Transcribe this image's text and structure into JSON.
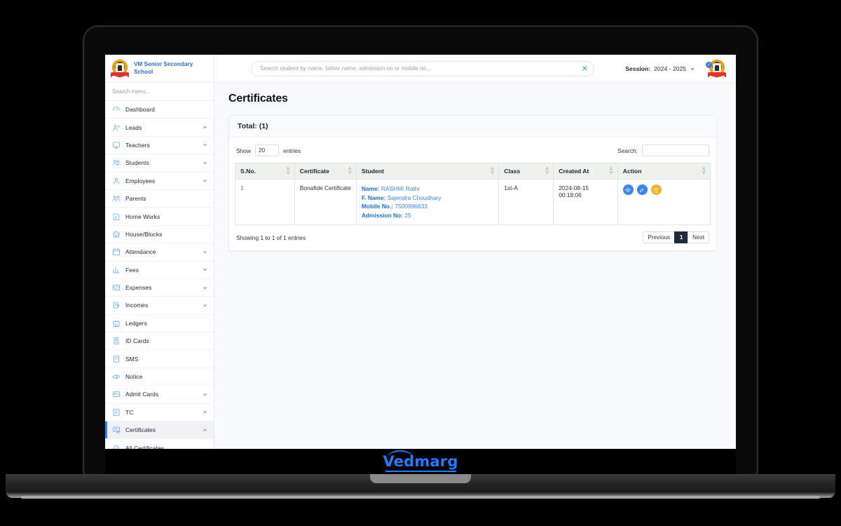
{
  "brand": {
    "school_name": "VM Senior Secondary School",
    "product_name": "Vedmarg"
  },
  "sidebar": {
    "search_placeholder": "Search menu...",
    "items": [
      {
        "label": "Dashboard",
        "icon": "speedometer-icon",
        "expandable": false,
        "active": false
      },
      {
        "label": "Leads",
        "icon": "leads-icon",
        "expandable": true,
        "active": false
      },
      {
        "label": "Teachers",
        "icon": "teacher-icon",
        "expandable": true,
        "active": false
      },
      {
        "label": "Students",
        "icon": "students-icon",
        "expandable": true,
        "active": false
      },
      {
        "label": "Employees",
        "icon": "employees-icon",
        "expandable": true,
        "active": false
      },
      {
        "label": "Parents",
        "icon": "parents-icon",
        "expandable": false,
        "active": false
      },
      {
        "label": "Home Works",
        "icon": "homework-icon",
        "expandable": false,
        "active": false
      },
      {
        "label": "House/Blocks",
        "icon": "house-icon",
        "expandable": false,
        "active": false
      },
      {
        "label": "Attendance",
        "icon": "calendar-icon",
        "expandable": true,
        "active": false
      },
      {
        "label": "Fees",
        "icon": "fees-icon",
        "expandable": true,
        "active": false
      },
      {
        "label": "Expenses",
        "icon": "expenses-icon",
        "expandable": true,
        "active": false
      },
      {
        "label": "Incomes",
        "icon": "incomes-icon",
        "expandable": true,
        "active": false
      },
      {
        "label": "Ledgers",
        "icon": "ledger-icon",
        "expandable": false,
        "active": false
      },
      {
        "label": "ID Cards",
        "icon": "id-card-icon",
        "expandable": false,
        "active": false
      },
      {
        "label": "SMS",
        "icon": "sms-icon",
        "expandable": false,
        "active": false
      },
      {
        "label": "Notice",
        "icon": "megaphone-icon",
        "expandable": false,
        "active": false
      },
      {
        "label": "Admit Cards",
        "icon": "admit-card-icon",
        "expandable": true,
        "active": false
      },
      {
        "label": "TC",
        "icon": "tc-icon",
        "expandable": true,
        "active": false
      },
      {
        "label": "Certificates",
        "icon": "certificate-icon",
        "expandable": true,
        "active": true
      },
      {
        "label": "All Certificates",
        "icon": "sub-item-icon",
        "expandable": false,
        "active": false
      }
    ]
  },
  "topbar": {
    "search_placeholder": "Search student by name, father name, admission no or mobile no...",
    "search_value": "",
    "clear_icon": "close-icon",
    "session_label": "Session:",
    "session_value": "2024 - 2025",
    "avatar_badge": "✓"
  },
  "page": {
    "title": "Certificates",
    "card_header": "Total: (1)"
  },
  "table_controls": {
    "show_label": "Show",
    "entries_label": "entries",
    "page_length": "20",
    "search_label": "Search:",
    "search_value": "",
    "search_placeholder": ""
  },
  "table": {
    "columns": [
      "S.No.",
      "Certificate",
      "Student",
      "Class",
      "Created At",
      "Action"
    ],
    "rows": [
      {
        "sno": "1",
        "certificate": "Bonafide Certificate",
        "student": {
          "name_label": "Name:",
          "name_value": "RASHMI Rathi",
          "father_label": "F. Name:",
          "father_value": "Sajendra Choudhary",
          "mobile_label": "Mobile No.:",
          "mobile_value": "7500996633",
          "admission_label": "Admission No:",
          "admission_value": "25"
        },
        "class": "1st-A",
        "created_at": "2024-08-15 00:18:06",
        "actions": [
          {
            "name": "view-button",
            "icon": "eye-icon",
            "color": "#3b82f6"
          },
          {
            "name": "edit-button",
            "icon": "pencil-icon",
            "color": "#3b82f6"
          },
          {
            "name": "delete-button",
            "icon": "trash-icon",
            "color": "#f0b429"
          }
        ]
      }
    ]
  },
  "footer": {
    "showing_info": "Showing 1 to 1 of 1 entries",
    "previous_label": "Previous",
    "current_page": "1",
    "next_label": "Next"
  },
  "colors": {
    "accent_blue": "#3b82f6",
    "brand_blue": "#2f6fe0",
    "warning_amber": "#f0b429",
    "header_bg": "#eef2ed",
    "active_page_bg": "#1f2a3a"
  }
}
